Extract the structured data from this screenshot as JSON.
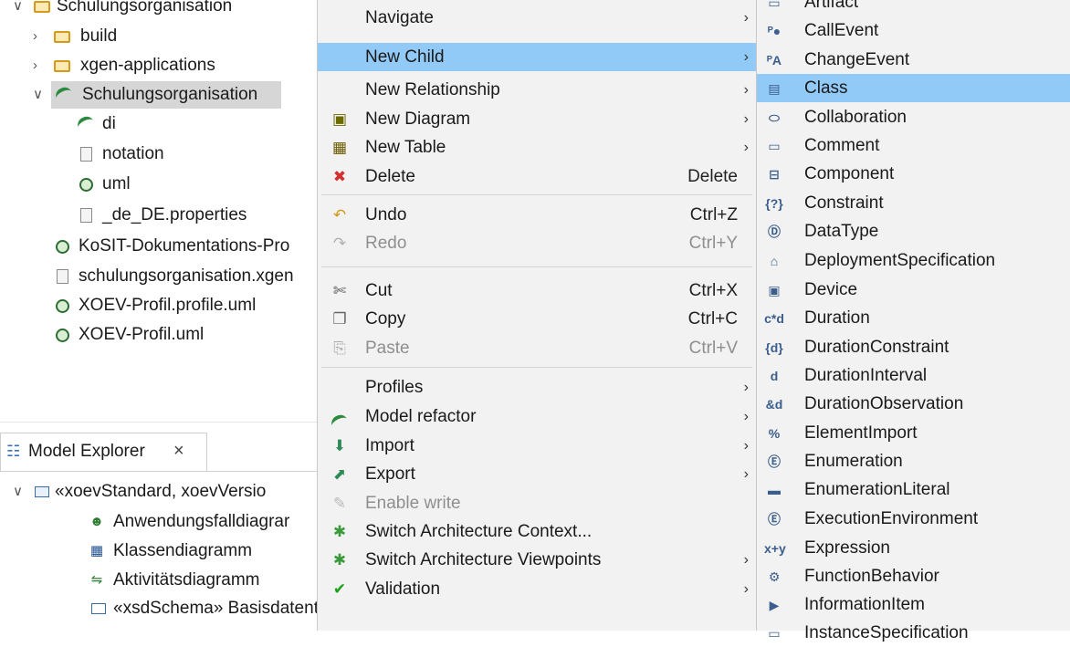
{
  "project_explorer": {
    "items": [
      {
        "label": "Schulungsorganisation",
        "icon": "folder-open-icon",
        "chevron": "v"
      },
      {
        "label": "build",
        "icon": "folder-icon",
        "chevron": ">"
      },
      {
        "label": "xgen-applications",
        "icon": "folder-icon",
        "chevron": ">"
      },
      {
        "label": "Schulungsorganisation",
        "icon": "papyrus-model-icon",
        "chevron": "v"
      },
      {
        "label": "di",
        "icon": "papyrus-model-icon"
      },
      {
        "label": "notation",
        "icon": "file-icon"
      },
      {
        "label": "uml",
        "icon": "uml-file-icon"
      },
      {
        "label": "_de_DE.properties",
        "icon": "file-icon"
      },
      {
        "label": "KoSIT-Dokumentations-Pro",
        "icon": "uml-file-icon"
      },
      {
        "label": "schulungsorganisation.xgen",
        "icon": "file-icon"
      },
      {
        "label": "XOEV-Profil.profile.uml",
        "icon": "uml-file-icon"
      },
      {
        "label": "XOEV-Profil.uml",
        "icon": "uml-file-icon"
      }
    ]
  },
  "model_explorer": {
    "tab_label": "Model Explorer",
    "tab_close": "×",
    "items": [
      {
        "label": "«xoevStandard, xoevVersio",
        "icon": "package-icon",
        "chevron": "v"
      },
      {
        "label": "Anwendungsfalldiagrar",
        "icon": "usecase-diagram-icon"
      },
      {
        "label": "Klassendiagramm",
        "icon": "class-diagram-icon"
      },
      {
        "label": "Aktivitätsdiagramm",
        "icon": "activity-diagram-icon"
      },
      {
        "label": "«xsdSchema» Basisdatentypen",
        "icon": "package-icon"
      }
    ]
  },
  "context_menu": {
    "items": [
      {
        "label": "Navigate",
        "submenu": true
      },
      {
        "label": "New Child",
        "submenu": true,
        "highlighted": true
      },
      {
        "label": "New Relationship",
        "submenu": true
      },
      {
        "label": "New Diagram",
        "submenu": true,
        "icon": "new-diagram-icon"
      },
      {
        "label": "New Table",
        "submenu": true,
        "icon": "new-table-icon"
      },
      {
        "label": "Delete",
        "accel": "Delete",
        "icon": "delete-icon"
      },
      {
        "label": "Undo",
        "accel": "Ctrl+Z",
        "icon": "undo-icon"
      },
      {
        "label": "Redo",
        "accel": "Ctrl+Y",
        "icon": "redo-icon",
        "disabled": true
      },
      {
        "label": "Cut",
        "accel": "Ctrl+X",
        "icon": "cut-icon"
      },
      {
        "label": "Copy",
        "accel": "Ctrl+C",
        "icon": "copy-icon"
      },
      {
        "label": "Paste",
        "accel": "Ctrl+V",
        "icon": "paste-icon",
        "disabled": true
      },
      {
        "label": "Profiles",
        "submenu": true
      },
      {
        "label": "Model refactor",
        "submenu": true,
        "icon": "papyrus-model-icon"
      },
      {
        "label": "Import",
        "submenu": true,
        "icon": "import-icon"
      },
      {
        "label": "Export",
        "submenu": true,
        "icon": "export-icon"
      },
      {
        "label": "Enable write",
        "icon": "pencil-icon",
        "disabled": true
      },
      {
        "label": "Switch Architecture Context...",
        "icon": "architecture-icon"
      },
      {
        "label": "Switch Architecture Viewpoints",
        "submenu": true,
        "icon": "architecture-icon"
      },
      {
        "label": "Validation",
        "submenu": true,
        "icon": "checkmark-icon"
      }
    ]
  },
  "submenu_new_child": {
    "items": [
      {
        "label": "Artifact",
        "icon": "artifact-icon",
        "glyph": "▭"
      },
      {
        "label": "CallEvent",
        "icon": "call-event-icon",
        "glyph": "ᴾ●"
      },
      {
        "label": "ChangeEvent",
        "icon": "change-event-icon",
        "glyph": "ᴾA"
      },
      {
        "label": "Class",
        "icon": "class-icon",
        "glyph": "▤",
        "highlighted": true
      },
      {
        "label": "Collaboration",
        "icon": "collaboration-icon",
        "glyph": "⬭"
      },
      {
        "label": "Comment",
        "icon": "comment-icon",
        "glyph": "▭"
      },
      {
        "label": "Component",
        "icon": "component-icon",
        "glyph": "⊟"
      },
      {
        "label": "Constraint",
        "icon": "constraint-icon",
        "glyph": "{?}"
      },
      {
        "label": "DataType",
        "icon": "datatype-icon",
        "glyph": "Ⓓ"
      },
      {
        "label": "DeploymentSpecification",
        "icon": "deployment-spec-icon",
        "glyph": "⌂"
      },
      {
        "label": "Device",
        "icon": "device-icon",
        "glyph": "▣"
      },
      {
        "label": "Duration",
        "icon": "duration-icon",
        "glyph": "c*d"
      },
      {
        "label": "DurationConstraint",
        "icon": "duration-constraint-icon",
        "glyph": "{d}"
      },
      {
        "label": "DurationInterval",
        "icon": "duration-interval-icon",
        "glyph": "d"
      },
      {
        "label": "DurationObservation",
        "icon": "duration-observation-icon",
        "glyph": "&d"
      },
      {
        "label": "ElementImport",
        "icon": "element-import-icon",
        "glyph": "%"
      },
      {
        "label": "Enumeration",
        "icon": "enumeration-icon",
        "glyph": "Ⓔ"
      },
      {
        "label": "EnumerationLiteral",
        "icon": "enumeration-literal-icon",
        "glyph": "▬"
      },
      {
        "label": "ExecutionEnvironment",
        "icon": "execution-environment-icon",
        "glyph": "Ⓔ"
      },
      {
        "label": "Expression",
        "icon": "expression-icon",
        "glyph": "x+y"
      },
      {
        "label": "FunctionBehavior",
        "icon": "function-behavior-icon",
        "glyph": "⚙"
      },
      {
        "label": "InformationItem",
        "icon": "information-item-icon",
        "glyph": "▶"
      },
      {
        "label": "InstanceSpecification",
        "icon": "instance-specification-icon",
        "glyph": "▭"
      }
    ]
  }
}
